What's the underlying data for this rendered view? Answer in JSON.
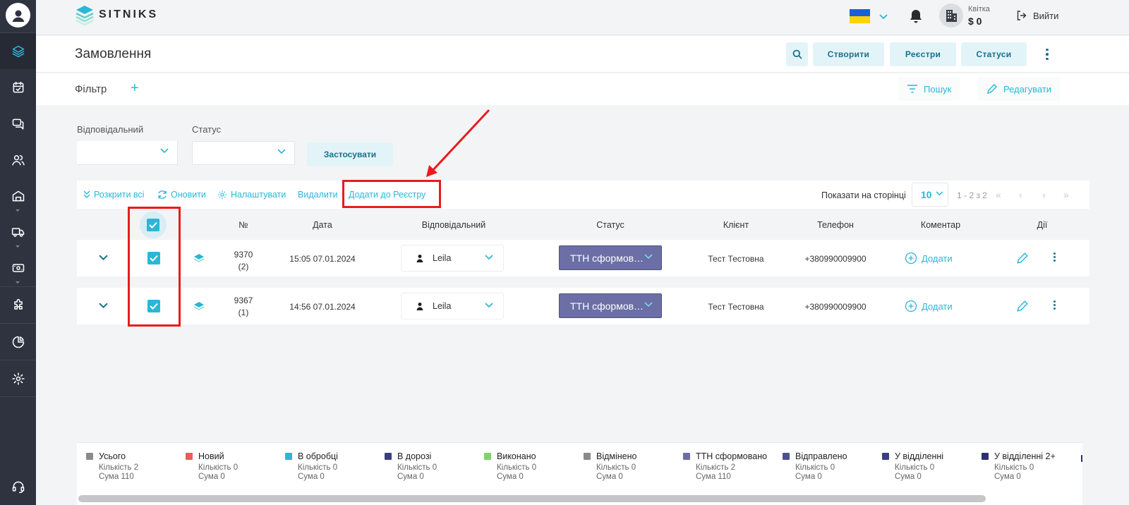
{
  "brand": {
    "name": "SITNIKS"
  },
  "account": {
    "label": "Квітка",
    "balance": "$ 0"
  },
  "topbar": {
    "logout_label": "Вийти"
  },
  "page": {
    "title": "Замовлення",
    "buttons": {
      "create": "Створити",
      "registries": "Реєстри",
      "statuses": "Статуси"
    }
  },
  "filter": {
    "title": "Фільтр",
    "search_label": "Пошук",
    "edit_label": "Редагувати",
    "responsible_label": "Відповідальний",
    "status_label": "Статус",
    "apply_label": "Застосувати"
  },
  "toolbar": {
    "expand_all": "Розкрити всі",
    "refresh": "Оновити",
    "settings": "Налаштувати",
    "delete": "Видалити",
    "add_to_registry": "Додати до Реєстру",
    "per_page_label": "Показати на сторінці",
    "per_page_value": "10",
    "range": "1 - 2 з 2"
  },
  "table": {
    "headers": {
      "num": "№",
      "date": "Дата",
      "responsible": "Відповідальний",
      "status": "Статус",
      "client": "Клієнт",
      "phone": "Телефон",
      "comment": "Коментар",
      "actions": "Дії"
    },
    "add_comment_label": "Додати",
    "rows": [
      {
        "num": "9370",
        "count": "(2)",
        "date": "15:05 07.01.2024",
        "responsible": "Leila",
        "status": "ТТН сформовано",
        "client": "Тест Тестовна",
        "phone": "+380990009900"
      },
      {
        "num": "9367",
        "count": "(1)",
        "date": "14:56 07.01.2024",
        "responsible": "Leila",
        "status": "ТТН сформовано",
        "client": "Тест Тестовна",
        "phone": "+380990009900"
      }
    ]
  },
  "summary": [
    {
      "name": "Усього",
      "count": "Кількість 2",
      "sum": "Сума 110",
      "color": "#8a8a8a"
    },
    {
      "name": "Новий",
      "count": "Кількість 0",
      "sum": "Сума 0",
      "color": "#f05a5a"
    },
    {
      "name": "В обробці",
      "count": "Кількість 0",
      "sum": "Сума 0",
      "color": "#2ab7d6"
    },
    {
      "name": "В дорозі",
      "count": "Кількість 0",
      "sum": "Сума 0",
      "color": "#3b3f80"
    },
    {
      "name": "Виконано",
      "count": "Кількість 0",
      "sum": "Сума 0",
      "color": "#7ed36a"
    },
    {
      "name": "Відмінено",
      "count": "Кількість 0",
      "sum": "Сума 0",
      "color": "#8a8a8a"
    },
    {
      "name": "ТТН сформовано",
      "count": "Кількість 2",
      "sum": "Сума 110",
      "color": "#6b6fa6"
    },
    {
      "name": "Відправлено",
      "count": "Кількість 0",
      "sum": "Сума 0",
      "color": "#4a4f8f"
    },
    {
      "name": "У відділенні",
      "count": "Кількість 0",
      "sum": "Сума 0",
      "color": "#3b3f80"
    },
    {
      "name": "У відділенні 2+",
      "count": "Кількість 0",
      "sum": "Сума 0",
      "color": "#2d3170"
    }
  ],
  "colors": {
    "accent": "#2ab7d6",
    "sidebar": "#2f3340",
    "status_pill": "#6b6fa6",
    "highlight": "#e81c1c"
  }
}
